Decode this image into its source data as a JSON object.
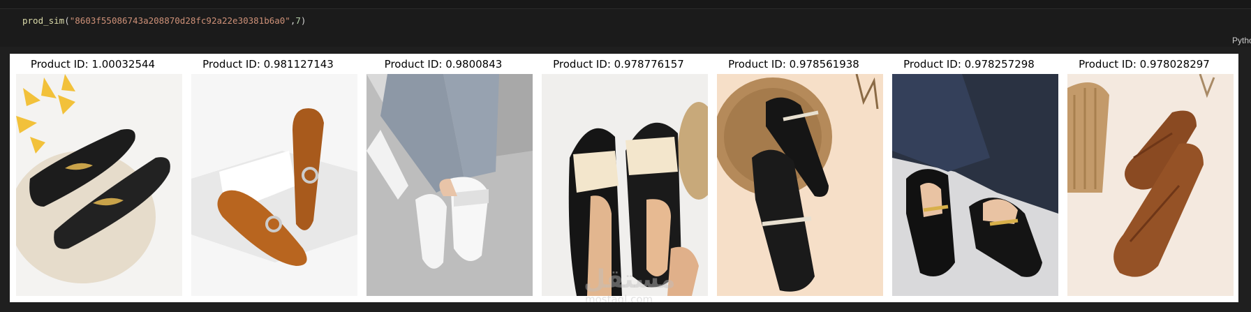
{
  "code": {
    "function": "prod_sim",
    "open_paren": "(",
    "string_arg": "\"8603f55086743a208870d28fc92a22e30381b6a0\"",
    "comma": ",",
    "number_arg": "7",
    "close_paren": ")"
  },
  "language_label": "Pytho",
  "products": [
    {
      "caption": "Product ID: 1.00032544",
      "icon": "black-croc-loafer-gold-chain-photo"
    },
    {
      "caption": "Product ID: 0.981127143",
      "icon": "tan-croc-loafer-chain-photo"
    },
    {
      "caption": "Product ID: 0.9800843",
      "icon": "white-fringe-loafer-worn-photo"
    },
    {
      "caption": "Product ID: 0.978776157",
      "icon": "black-cream-fringe-loafer-photo"
    },
    {
      "caption": "Product ID: 0.978561938",
      "icon": "black-croc-loafer-pearl-chain-photo"
    },
    {
      "caption": "Product ID: 0.978257298",
      "icon": "black-patent-loafer-worn-photo"
    },
    {
      "caption": "Product ID: 0.978028297",
      "icon": "brown-croc-loafer-photo"
    }
  ],
  "watermark": {
    "logo": "مستقل",
    "text": "mostaql.com"
  },
  "colors": {
    "background": "#1f1f1f",
    "output_bg": "#ffffff",
    "code_function": "#dcdcaa",
    "code_string": "#ce9178",
    "code_number": "#b5cea8"
  }
}
